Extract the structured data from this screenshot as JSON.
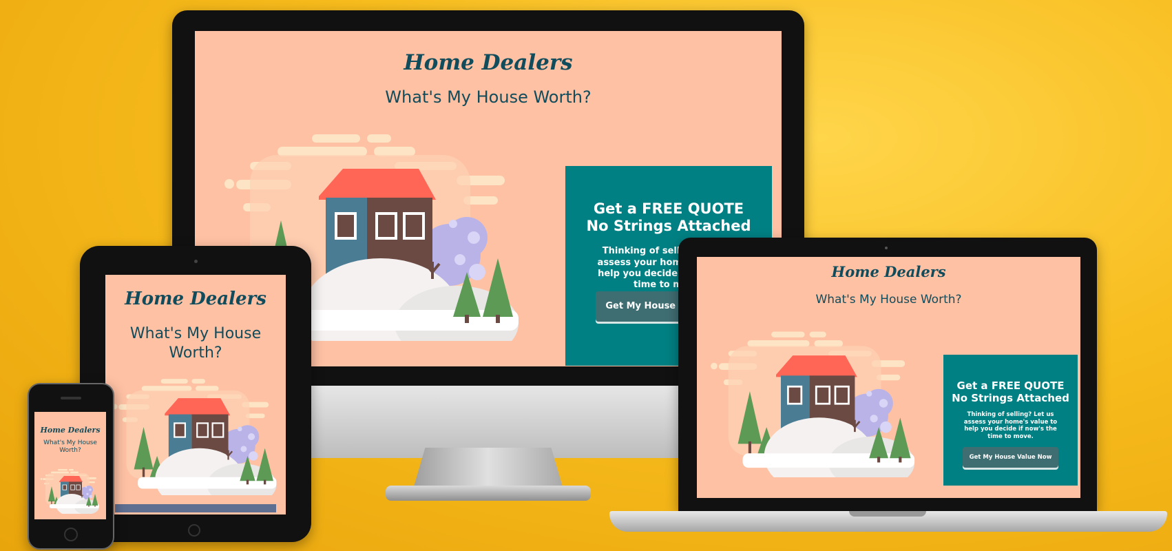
{
  "site": {
    "brand": "Home Dealers",
    "headline": "What's My House Worth?",
    "quote_title": "Get a FREE QUOTE\nNo Strings Attached",
    "quote_title_cut": "Get a FREE QUOTE\nNo Strings Attached",
    "quote_body": "Thinking of selling? Let us assess your home's value to help you decide if now's the time to move.",
    "cta_label": "Get My House Value Now",
    "tablet_headline": "What's My House Worth?",
    "phone_headline": "What's My House Worth?"
  },
  "colors": {
    "background": "#f7bc1d",
    "page_bg": "#fec1a4",
    "brand_text": "#114c5c",
    "quote_panel": "#008083",
    "cta_button": "#3f6e72",
    "roof": "#ff6655",
    "house_blue": "#4a7d94",
    "house_brown": "#6b4a43",
    "tree_green": "#5c9a55"
  },
  "devices": [
    "desktop-monitor",
    "laptop",
    "tablet",
    "phone"
  ]
}
